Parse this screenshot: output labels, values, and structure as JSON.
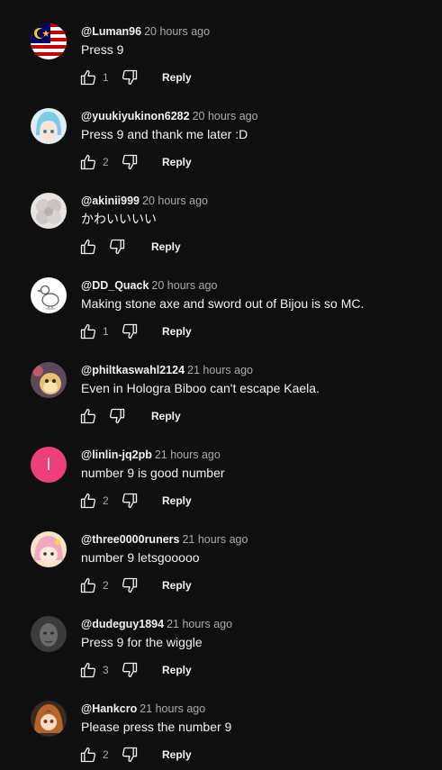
{
  "comments": [
    {
      "author": "@Luman96",
      "time": "20 hours ago",
      "text": "Press 9",
      "likes": "1",
      "reply_label": "Reply",
      "avatar": "malaysia-flag"
    },
    {
      "author": "@yuukiyukinon6282",
      "time": "20 hours ago",
      "text": "Press 9 and thank me later :D",
      "likes": "2",
      "reply_label": "Reply",
      "avatar": "anime-blue-hair"
    },
    {
      "author": "@akinii999",
      "time": "20 hours ago",
      "text": "かわいいいい",
      "likes": "",
      "reply_label": "Reply",
      "avatar": "pale-flower"
    },
    {
      "author": "@DD_Quack",
      "time": "20 hours ago",
      "text": "Making stone axe and sword out of Bijou is so MC.",
      "likes": "1",
      "reply_label": "Reply",
      "avatar": "duck-sketch"
    },
    {
      "author": "@philtkaswahl2124",
      "time": "21 hours ago",
      "text": "Even in Hologra Biboo can't escape Kaela.",
      "likes": "",
      "reply_label": "Reply",
      "avatar": "plush-figure"
    },
    {
      "author": "@linlin-jq2pb",
      "time": "21 hours ago",
      "text": "number 9 is good number",
      "likes": "2",
      "reply_label": "Reply",
      "avatar": "letter-l",
      "avatar_letter": "l",
      "avatar_color": "#ec407a"
    },
    {
      "author": "@three0000runers",
      "time": "21 hours ago",
      "text": "number 9 letsgooooo",
      "likes": "2",
      "reply_label": "Reply",
      "avatar": "pink-anime"
    },
    {
      "author": "@dudeguy1894",
      "time": "21 hours ago",
      "text": "Press 9 for the wiggle",
      "likes": "3",
      "reply_label": "Reply",
      "avatar": "grey-face"
    },
    {
      "author": "@Hankcro",
      "time": "21 hours ago",
      "text": "Please press the number 9",
      "likes": "2",
      "reply_label": "Reply",
      "avatar": "anime-brown-hair"
    }
  ]
}
